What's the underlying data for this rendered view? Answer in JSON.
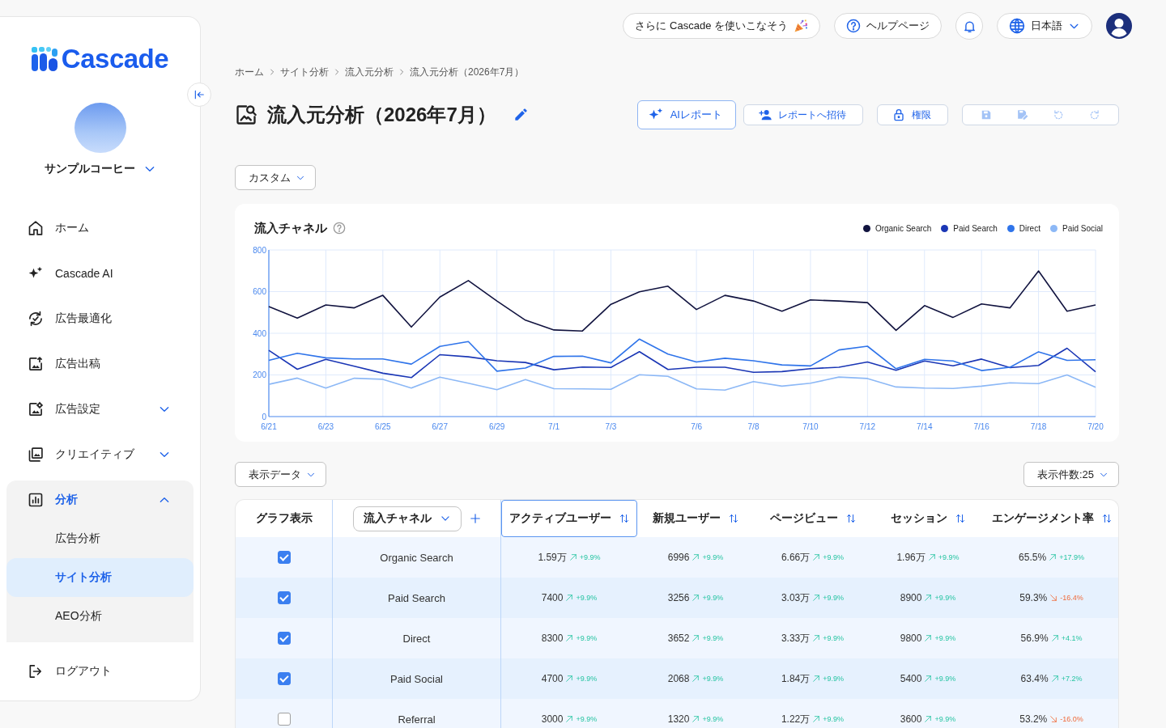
{
  "sidebar": {
    "logo": "Cascade",
    "account": {
      "name": "サンプルコーヒー"
    },
    "nav": [
      {
        "label": "ホーム",
        "kind": "link",
        "selected": false
      },
      {
        "label": "Cascade AI",
        "kind": "link",
        "selected": false
      },
      {
        "label": "広告最適化",
        "kind": "link",
        "selected": false
      },
      {
        "label": "広告出稿",
        "kind": "link",
        "selected": false
      },
      {
        "label": "広告設定",
        "kind": "group",
        "selected": false,
        "expanded": false
      },
      {
        "label": "クリエイティブ",
        "kind": "group",
        "selected": false,
        "expanded": false
      },
      {
        "label": "分析",
        "kind": "group",
        "selected": false,
        "expanded": true,
        "children": [
          {
            "label": "広告分析",
            "selected": false
          },
          {
            "label": "サイト分析",
            "selected": true
          },
          {
            "label": "AEO分析",
            "selected": false
          }
        ]
      }
    ],
    "logout": "ログアウト"
  },
  "topbar": {
    "promo": "さらに Cascade を使いこなそう",
    "help": "ヘルプページ",
    "language": "日本語"
  },
  "breadcrumb": [
    "ホーム",
    "サイト分析",
    "流入元分析",
    "流入元分析（2026年7月）"
  ],
  "page": {
    "title": "流入元分析（2026年7月）",
    "actions": [
      {
        "label": "AIレポート",
        "kind": "primary"
      },
      {
        "label": "レポートへ招待",
        "kind": "secondary"
      },
      {
        "label": "権限",
        "kind": "secondary"
      }
    ],
    "history_tools": [
      {
        "disabled": true
      },
      {
        "disabled": true
      },
      {
        "disabled": true
      },
      {
        "disabled": true
      }
    ]
  },
  "filters": {
    "period": "カスタム"
  },
  "chart_card": {
    "title": "流入チャネル",
    "chart_data": {
      "type": "line",
      "categories": [
        "6/21",
        null,
        "6/23",
        null,
        "6/25",
        null,
        "6/27",
        null,
        "6/29",
        null,
        "7/1",
        null,
        "7/3",
        null,
        null,
        "7/6",
        null,
        "7/8",
        null,
        "7/10",
        null,
        "7/12",
        null,
        "7/14",
        null,
        "7/16",
        null,
        "7/18",
        null,
        "7/20"
      ],
      "ylim": [
        0,
        800
      ],
      "yticks": [
        0,
        200,
        400,
        600,
        800
      ],
      "grid": true,
      "series": [
        {
          "name": "Organic Search",
          "color": "#11133f",
          "values": [
            528,
            473,
            536,
            522,
            582,
            430,
            574,
            653,
            555,
            463,
            416,
            411,
            539,
            599,
            626,
            514,
            582,
            555,
            506,
            560,
            555,
            547,
            414,
            533,
            476,
            541,
            522,
            699,
            506,
            536
          ]
        },
        {
          "name": "Paid Search",
          "color": "#1a36b5",
          "values": [
            318,
            227,
            275,
            242,
            208,
            187,
            297,
            287,
            268,
            260,
            225,
            238,
            236,
            312,
            226,
            237,
            237,
            213,
            216,
            230,
            237,
            262,
            222,
            267,
            244,
            276,
            235,
            246,
            328,
            215
          ]
        },
        {
          "name": "Direct",
          "color": "#2f74ea",
          "values": [
            270,
            304,
            282,
            277,
            277,
            252,
            337,
            360,
            218,
            233,
            289,
            290,
            258,
            372,
            300,
            262,
            280,
            268,
            248,
            243,
            320,
            338,
            230,
            275,
            267,
            221,
            237,
            311,
            270,
            273
          ]
        },
        {
          "name": "Paid Social",
          "color": "#8cb8f6",
          "values": [
            155,
            185,
            137,
            184,
            179,
            137,
            189,
            160,
            129,
            178,
            134,
            133,
            131,
            201,
            193,
            133,
            127,
            168,
            146,
            160,
            190,
            183,
            142,
            137,
            135,
            146,
            162,
            158,
            200,
            141
          ]
        }
      ]
    }
  },
  "table_controls": {
    "columns_menu": "表示データ",
    "page_size": "表示件数:25"
  },
  "table": {
    "graph_column": "グラフ表示",
    "channel_column": "流入チャネル",
    "columns": [
      {
        "label": "アクティブユーザー",
        "selected": true
      },
      {
        "label": "新規ユーザー",
        "selected": false
      },
      {
        "label": "ページビュー",
        "selected": false
      },
      {
        "label": "セッション",
        "selected": false
      },
      {
        "label": "エンゲージメント率",
        "selected": false
      }
    ],
    "rows": [
      {
        "checked": true,
        "channel": "Organic Search",
        "cells": [
          {
            "value": "1.59万",
            "change": "+9.9%",
            "positive": true
          },
          {
            "value": "6996",
            "change": "+9.9%",
            "positive": true
          },
          {
            "value": "6.66万",
            "change": "+9.9%",
            "positive": true
          },
          {
            "value": "1.96万",
            "change": "+9.9%",
            "positive": true
          },
          {
            "value": "65.5%",
            "change": "+17.9%",
            "positive": true
          }
        ]
      },
      {
        "checked": true,
        "channel": "Paid Search",
        "cells": [
          {
            "value": "7400",
            "change": "+9.9%",
            "positive": true
          },
          {
            "value": "3256",
            "change": "+9.9%",
            "positive": true
          },
          {
            "value": "3.03万",
            "change": "+9.9%",
            "positive": true
          },
          {
            "value": "8900",
            "change": "+9.9%",
            "positive": true
          },
          {
            "value": "59.3%",
            "change": "-16.4%",
            "positive": false
          }
        ]
      },
      {
        "checked": true,
        "channel": "Direct",
        "cells": [
          {
            "value": "8300",
            "change": "+9.9%",
            "positive": true
          },
          {
            "value": "3652",
            "change": "+9.9%",
            "positive": true
          },
          {
            "value": "3.33万",
            "change": "+9.9%",
            "positive": true
          },
          {
            "value": "9800",
            "change": "+9.9%",
            "positive": true
          },
          {
            "value": "56.9%",
            "change": "+4.1%",
            "positive": true
          }
        ]
      },
      {
        "checked": true,
        "channel": "Paid Social",
        "cells": [
          {
            "value": "4700",
            "change": "+9.9%",
            "positive": true
          },
          {
            "value": "2068",
            "change": "+9.9%",
            "positive": true
          },
          {
            "value": "1.84万",
            "change": "+9.9%",
            "positive": true
          },
          {
            "value": "5400",
            "change": "+9.9%",
            "positive": true
          },
          {
            "value": "63.4%",
            "change": "+7.2%",
            "positive": true
          }
        ]
      },
      {
        "checked": false,
        "channel": "Referral",
        "cells": [
          {
            "value": "3000",
            "change": "+9.9%",
            "positive": true
          },
          {
            "value": "1320",
            "change": "+9.9%",
            "positive": true
          },
          {
            "value": "1.22万",
            "change": "+9.9%",
            "positive": true
          },
          {
            "value": "3600",
            "change": "+9.9%",
            "positive": true
          },
          {
            "value": "53.2%",
            "change": "-16.0%",
            "positive": false
          }
        ]
      }
    ]
  }
}
